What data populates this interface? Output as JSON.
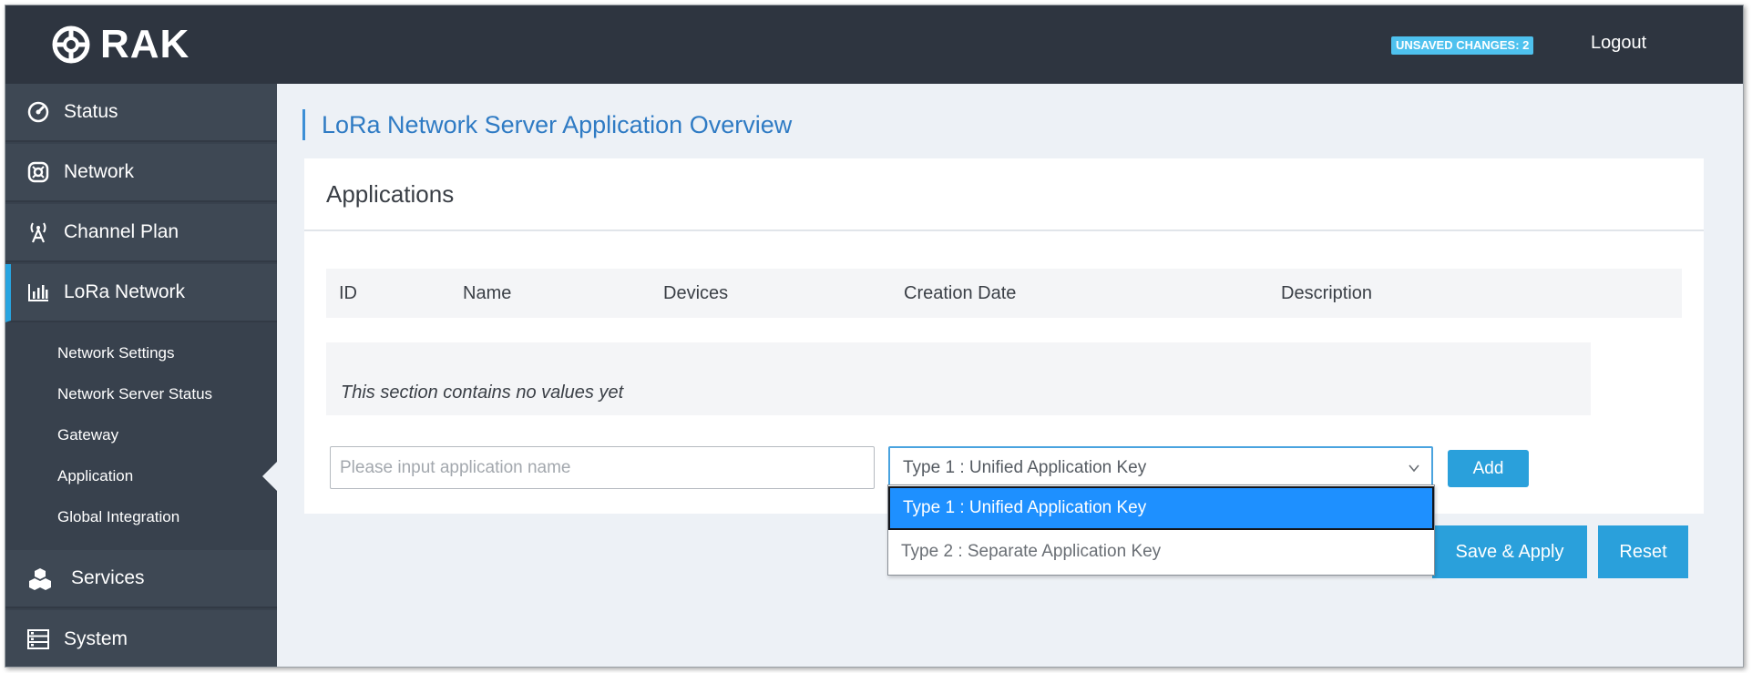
{
  "header": {
    "logo_text": "RAK",
    "unsaved_badge": "UNSAVED CHANGES: 2",
    "logout_label": "Logout"
  },
  "sidebar": {
    "items": [
      {
        "label": "Status",
        "icon": "gauge-icon"
      },
      {
        "label": "Network",
        "icon": "network-icon"
      },
      {
        "label": "Channel Plan",
        "icon": "antenna-icon"
      },
      {
        "label": "LoRa Network",
        "icon": "signal-bars-icon",
        "active": true
      },
      {
        "label": "Services",
        "icon": "cubes-icon"
      },
      {
        "label": "System",
        "icon": "server-icon"
      }
    ],
    "submenu": [
      {
        "label": "Network Settings"
      },
      {
        "label": "Network Server Status"
      },
      {
        "label": "Gateway"
      },
      {
        "label": "Application",
        "active": true
      },
      {
        "label": "Global Integration"
      }
    ]
  },
  "main": {
    "page_title": "LoRa Network Server Application Overview",
    "card_title": "Applications",
    "table": {
      "columns": [
        "ID",
        "Name",
        "Devices",
        "Creation Date",
        "Description"
      ],
      "empty_text": "This section contains no values yet"
    },
    "form": {
      "name_placeholder": "Please input application name",
      "type_value": "Type 1 : Unified Application Key",
      "type_options": [
        "Type 1 : Unified Application Key",
        "Type 2 : Separate Application Key"
      ],
      "add_label": "Add"
    },
    "save_apply_label": "Save & Apply",
    "reset_label": "Reset"
  },
  "colors": {
    "header_bg": "#2e3540",
    "sidebar_bg": "#38414d",
    "accent": "#2aa0db",
    "title_blue": "#2f7bc4"
  }
}
